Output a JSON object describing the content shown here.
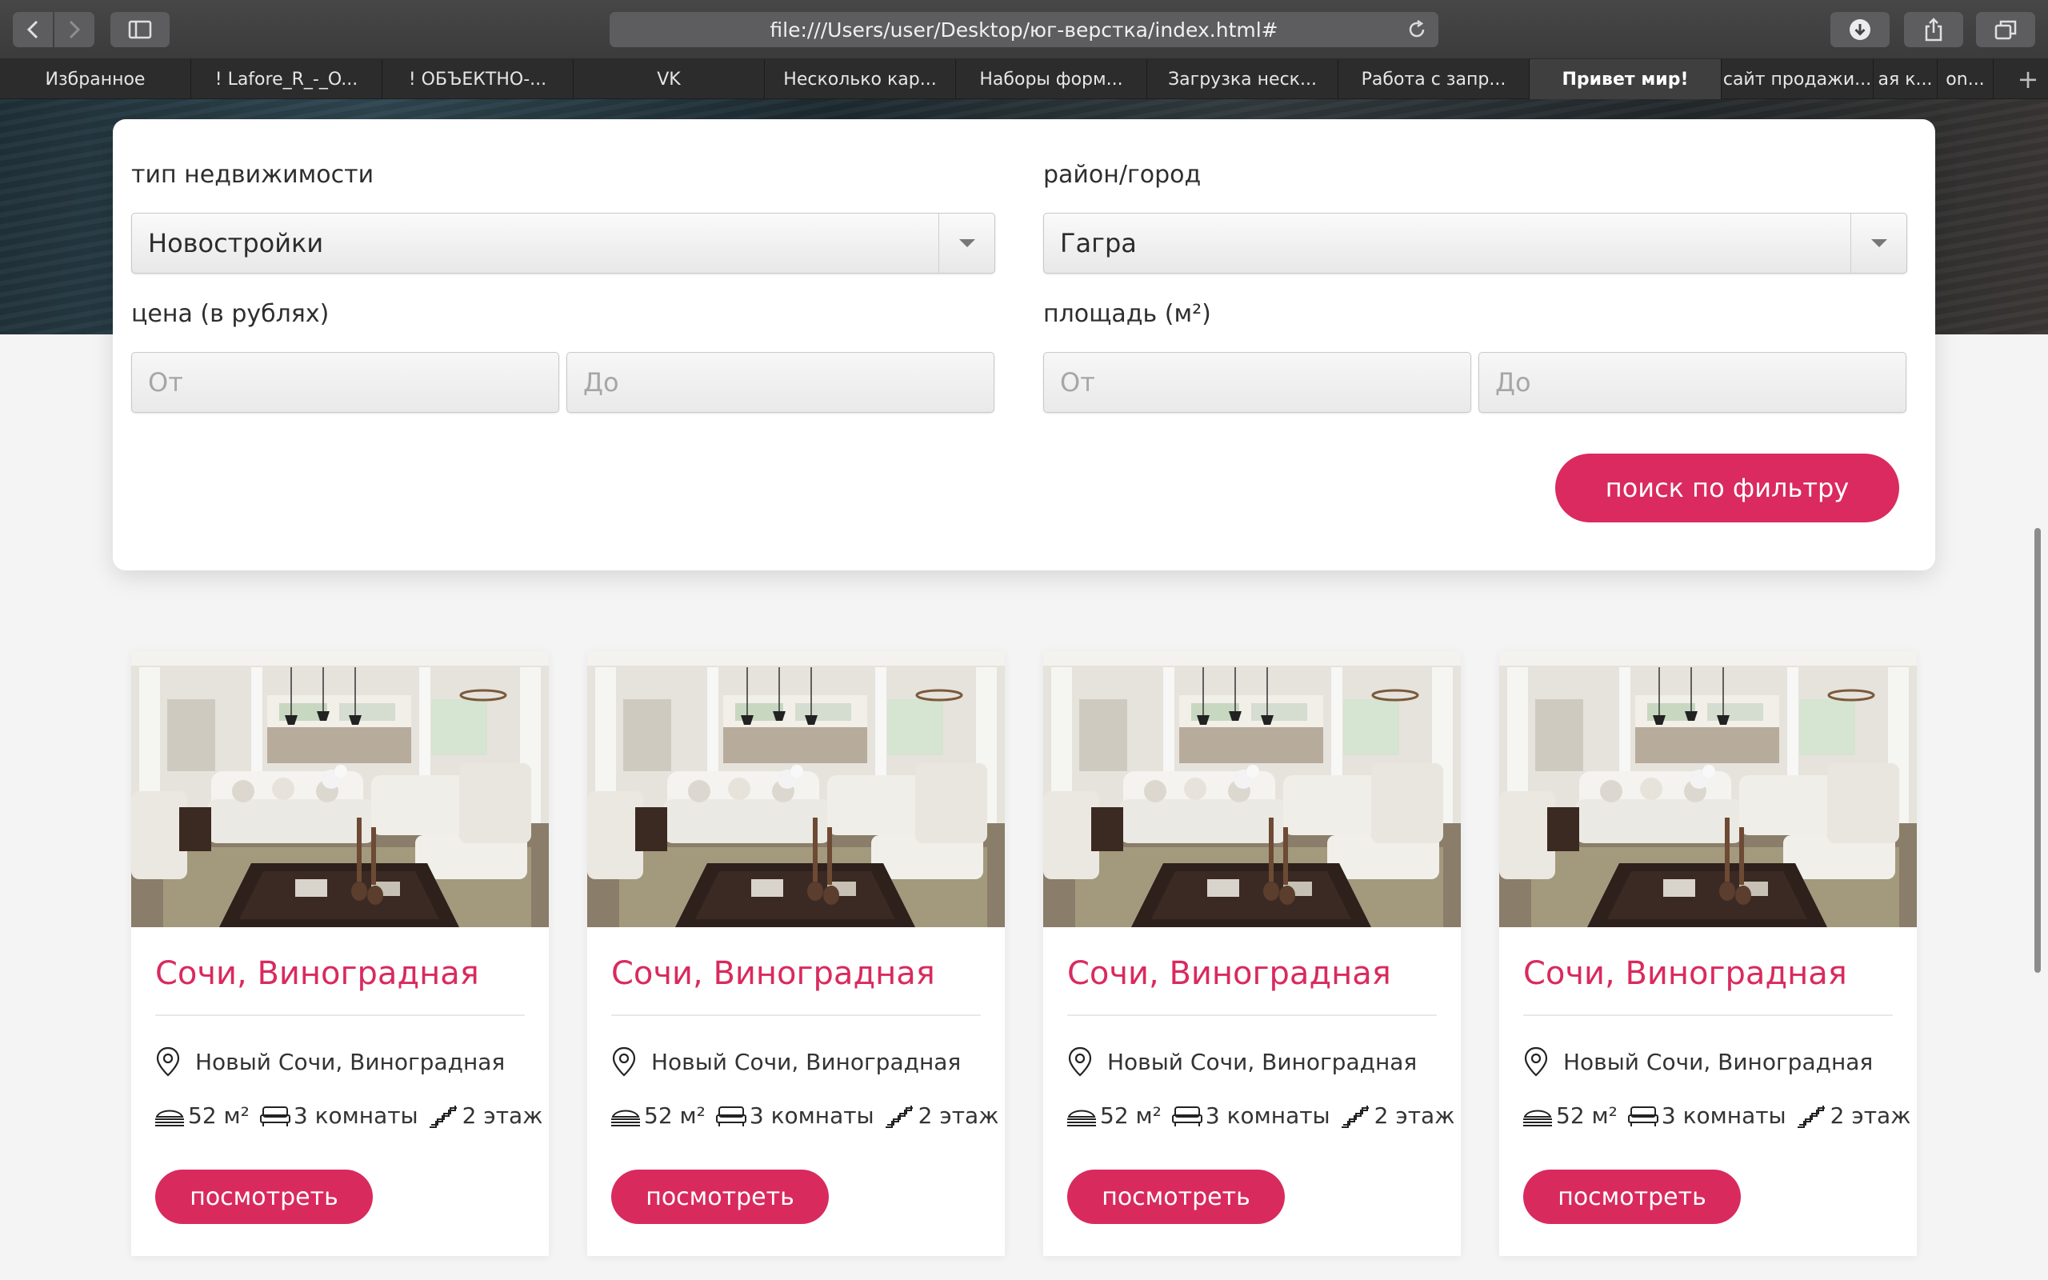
{
  "browser": {
    "url": "file:///Users/user/Desktop/юг-верстка/index.html#",
    "tabs": [
      {
        "label": "Избранное",
        "active": false
      },
      {
        "label": "! Lafore_R_-_O...",
        "active": false
      },
      {
        "label": "! ОБЪЕКТНО-...",
        "active": false
      },
      {
        "label": "VK",
        "active": false
      },
      {
        "label": "Несколько кар...",
        "active": false
      },
      {
        "label": "Наборы форм...",
        "active": false
      },
      {
        "label": "Загрузка неск...",
        "active": false
      },
      {
        "label": "Работа с запр...",
        "active": false
      },
      {
        "label": "Привет мир!",
        "active": true
      },
      {
        "label": "сайт продажи...",
        "active": false
      },
      {
        "label": "ая к...",
        "active": false
      },
      {
        "label": "on...",
        "active": false
      }
    ],
    "new_tab": "+"
  },
  "filter": {
    "type_label": "тип недвижимости",
    "type_value": "Новостройки",
    "district_label": "район/город",
    "district_value": "Гагра",
    "price_label": "цена (в рублях)",
    "price_from_placeholder": "От",
    "price_to_placeholder": "До",
    "area_label": "площадь (м²)",
    "area_from_placeholder": "От",
    "area_to_placeholder": "До",
    "search_button": "поиск по фильтру"
  },
  "cards": [
    {
      "title": "Сочи, Виноградная",
      "address": "Новый Сочи, Виноградная",
      "area": "52 м²",
      "rooms": "3 комнаты",
      "floor": "2 этаж",
      "button": "посмотреть"
    },
    {
      "title": "Сочи, Виноградная",
      "address": "Новый Сочи, Виноградная",
      "area": "52 м²",
      "rooms": "3 комнаты",
      "floor": "2 этаж",
      "button": "посмотреть"
    },
    {
      "title": "Сочи, Виноградная",
      "address": "Новый Сочи, Виноградная",
      "area": "52 м²",
      "rooms": "3 комнаты",
      "floor": "2 этаж",
      "button": "посмотреть"
    },
    {
      "title": "Сочи, Виноградная",
      "address": "Новый Сочи, Виноградная",
      "area": "52 м²",
      "rooms": "3 комнаты",
      "floor": "2 этаж",
      "button": "посмотреть"
    }
  ],
  "colors": {
    "accent": "#da2a5f",
    "page_bg": "#f4f4f4",
    "card_bg": "#ffffff"
  }
}
